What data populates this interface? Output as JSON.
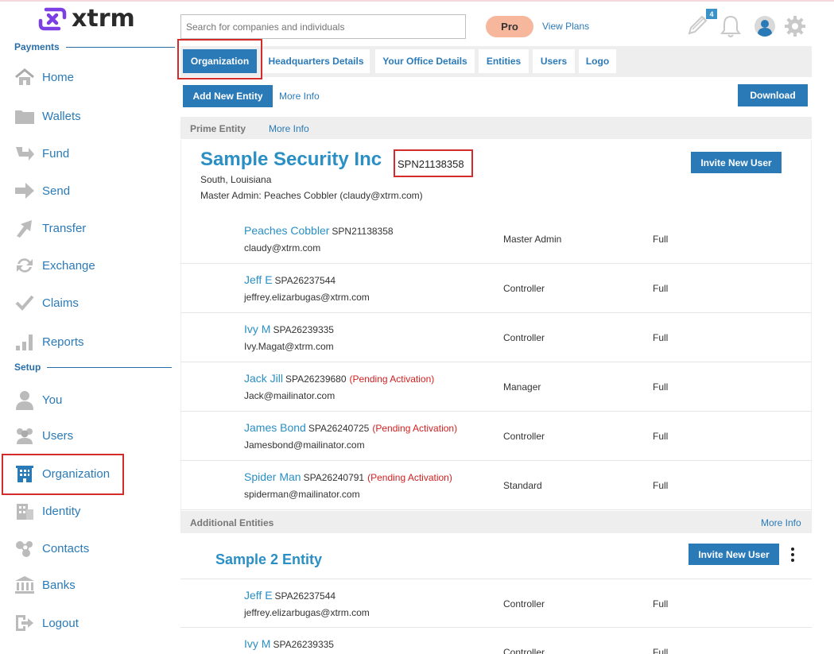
{
  "brand": {
    "name": "xtrm",
    "color": "#7b3fe4"
  },
  "sidebar": {
    "payments_title": "Payments",
    "setup_title": "Setup",
    "payments_items": [
      {
        "label": "Home",
        "icon": "home-icon"
      },
      {
        "label": "Wallets",
        "icon": "folder-icon"
      },
      {
        "label": "Fund",
        "icon": "fund-arrow-icon"
      },
      {
        "label": "Send",
        "icon": "send-arrow-icon"
      },
      {
        "label": "Transfer",
        "icon": "transfer-arrow-icon"
      },
      {
        "label": "Exchange",
        "icon": "exchange-icon"
      },
      {
        "label": "Claims",
        "icon": "checkmark-icon"
      },
      {
        "label": "Reports",
        "icon": "bar-chart-icon"
      }
    ],
    "setup_items": [
      {
        "label": "You",
        "icon": "person-icon"
      },
      {
        "label": "Users",
        "icon": "users-icon"
      },
      {
        "label": "Organization",
        "icon": "building-icon"
      },
      {
        "label": "Identity",
        "icon": "identity-icon"
      },
      {
        "label": "Contacts",
        "icon": "contacts-icon"
      },
      {
        "label": "Banks",
        "icon": "bank-icon"
      },
      {
        "label": "Logout",
        "icon": "logout-icon"
      }
    ]
  },
  "header": {
    "search_placeholder": "Search for companies and individuals",
    "pro_label": "Pro",
    "view_plans": "View Plans",
    "notification_count": "4"
  },
  "tabs": [
    {
      "label": "Organization",
      "active": true
    },
    {
      "label": "Headquarters Details"
    },
    {
      "label": "Your Office Details"
    },
    {
      "label": "Entities"
    },
    {
      "label": "Users"
    },
    {
      "label": "Logo"
    }
  ],
  "actions": {
    "add_entity": "Add New Entity",
    "more_info": "More Info",
    "download": "Download"
  },
  "prime": {
    "bar_title": "Prime Entity",
    "bar_more_info": "More Info",
    "name": "Sample Security Inc",
    "spn": "SPN21138358",
    "location": "South, Louisiana",
    "master_admin": "Master Admin: Peaches Cobbler (claudy@xtrm.com)",
    "invite_button": "Invite New User",
    "users": [
      {
        "name": "Peaches Cobbler",
        "id": "SPN21138358",
        "pending": "",
        "email": "claudy@xtrm.com",
        "role": "Master Admin",
        "access": "Full"
      },
      {
        "name": "Jeff E",
        "id": "SPA26237544",
        "pending": "",
        "email": "jeffrey.elizarbugas@xtrm.com",
        "role": "Controller",
        "access": "Full"
      },
      {
        "name": "Ivy M",
        "id": "SPA26239335",
        "pending": "",
        "email": "Ivy.Magat@xtrm.com",
        "role": "Controller",
        "access": "Full"
      },
      {
        "name": "Jack Jill",
        "id": "SPA26239680",
        "pending": "(Pending Activation)",
        "email": "Jack@mailinator.com",
        "role": "Manager",
        "access": "Full"
      },
      {
        "name": "James Bond",
        "id": "SPA26240725",
        "pending": "(Pending Activation)",
        "email": "Jamesbond@mailinator.com",
        "role": "Controller",
        "access": "Full"
      },
      {
        "name": "Spider Man",
        "id": "SPA26240791",
        "pending": "(Pending Activation)",
        "email": "spiderman@mailinator.com",
        "role": "Standard",
        "access": "Full"
      }
    ]
  },
  "additional": {
    "bar_title": "Additional Entities",
    "bar_more_info": "More Info",
    "name": "Sample 2 Entity",
    "invite_button": "Invite New User",
    "users": [
      {
        "name": "Jeff E",
        "id": "SPA26237544",
        "email": "jeffrey.elizarbugas@xtrm.com",
        "role": "Controller",
        "access": "Full"
      },
      {
        "name": "Ivy M",
        "id": "SPA26239335",
        "email": "",
        "role": "Controller",
        "access": "Full"
      }
    ]
  }
}
